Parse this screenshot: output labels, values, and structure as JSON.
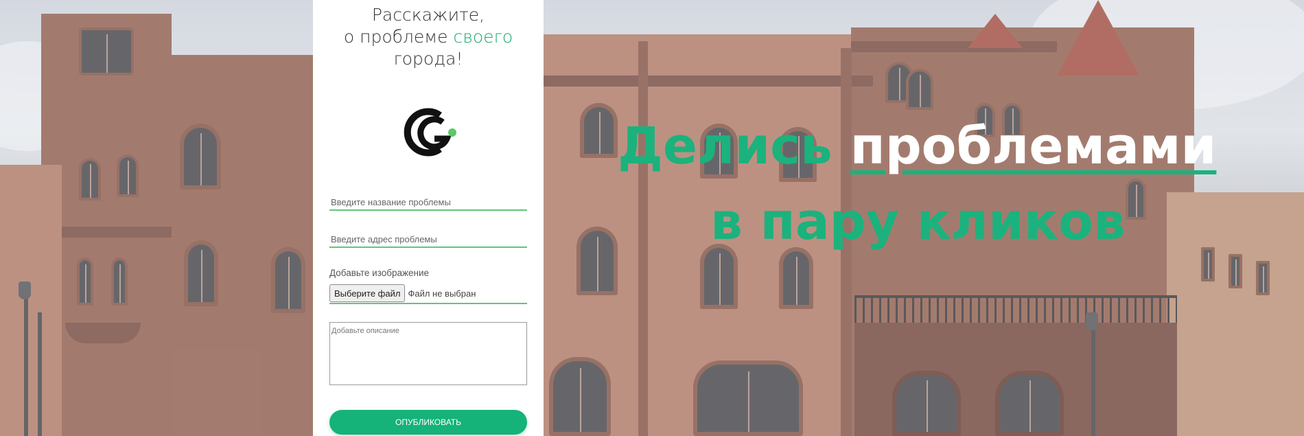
{
  "form": {
    "title_line1": "Расскажите,",
    "title_line2_pre": "о проблеме ",
    "title_line2_accent": "своего",
    "title_line3": "города!",
    "logo_icon": "cg-logo-icon",
    "name_placeholder": "Введите название проблемы",
    "address_placeholder": "Введите адрес проблемы",
    "image_label": "Добавьте изображение",
    "file_button": "Выберите файл",
    "file_status": "Файл не выбран",
    "description_placeholder": "Добавьте описание",
    "submit_label": "ОПУБЛИКОВАТЬ"
  },
  "hero": {
    "word1": "Делись",
    "word2": "проблемами",
    "line2": "в пару кликов"
  },
  "colors": {
    "accent": "#1bb27d",
    "field_underline": "#63c47a",
    "building": "#a9735f",
    "roof": "#9c4438"
  }
}
